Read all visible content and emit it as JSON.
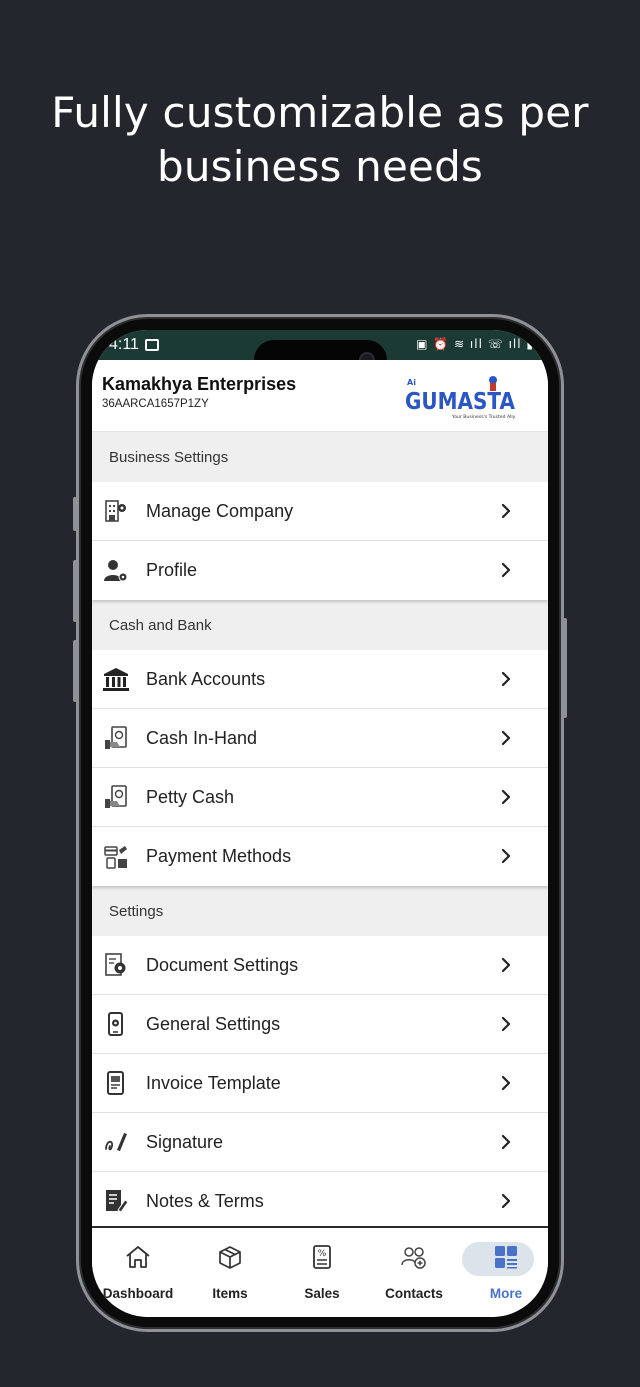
{
  "headline": {
    "line1": "Fully customizable as per",
    "line2": "business needs"
  },
  "status_bar": {
    "time": "4:11",
    "right_icons": "▣ ⏰ ≋ ıll ☏ ıll ▮"
  },
  "app_bar": {
    "company_name": "Kamakhya Enterprises",
    "gst_number": "36AARCA1657P1ZY",
    "logo": {
      "text": "GUMASTA",
      "tagline": "Your Business's Trusted Ally",
      "prefix": "Ai",
      "color": "#2a57c4"
    }
  },
  "sections": [
    {
      "title": "Business Settings",
      "items": [
        {
          "label": "Manage Company",
          "icon": "building-gear-icon"
        },
        {
          "label": "Profile",
          "icon": "user-gear-icon"
        }
      ]
    },
    {
      "title": "Cash and Bank",
      "items": [
        {
          "label": "Bank Accounts",
          "icon": "bank-icon"
        },
        {
          "label": "Cash In-Hand",
          "icon": "cash-hand-icon"
        },
        {
          "label": "Petty Cash",
          "icon": "petty-cash-icon"
        },
        {
          "label": "Payment Methods",
          "icon": "payment-methods-icon"
        }
      ]
    },
    {
      "title": "Settings",
      "items": [
        {
          "label": "Document Settings",
          "icon": "document-gear-icon"
        },
        {
          "label": "General Settings",
          "icon": "phone-gear-icon"
        },
        {
          "label": "Invoice Template",
          "icon": "invoice-template-icon"
        },
        {
          "label": "Signature",
          "icon": "signature-icon"
        },
        {
          "label": "Notes & Terms",
          "icon": "notes-pen-icon"
        }
      ]
    }
  ],
  "bottom_nav": [
    {
      "label": "Dashboard",
      "icon": "home-icon",
      "active": false
    },
    {
      "label": "Items",
      "icon": "box-icon",
      "active": false
    },
    {
      "label": "Sales",
      "icon": "receipt-icon",
      "active": false
    },
    {
      "label": "Contacts",
      "icon": "contacts-icon",
      "active": false
    },
    {
      "label": "More",
      "icon": "grid-icon",
      "active": true
    }
  ],
  "colors": {
    "background": "#23272d",
    "status_bar": "#1c3a34",
    "section_header_bg": "#efefef",
    "active_nav": "#4a73c8",
    "active_pill": "#dde3ea"
  }
}
